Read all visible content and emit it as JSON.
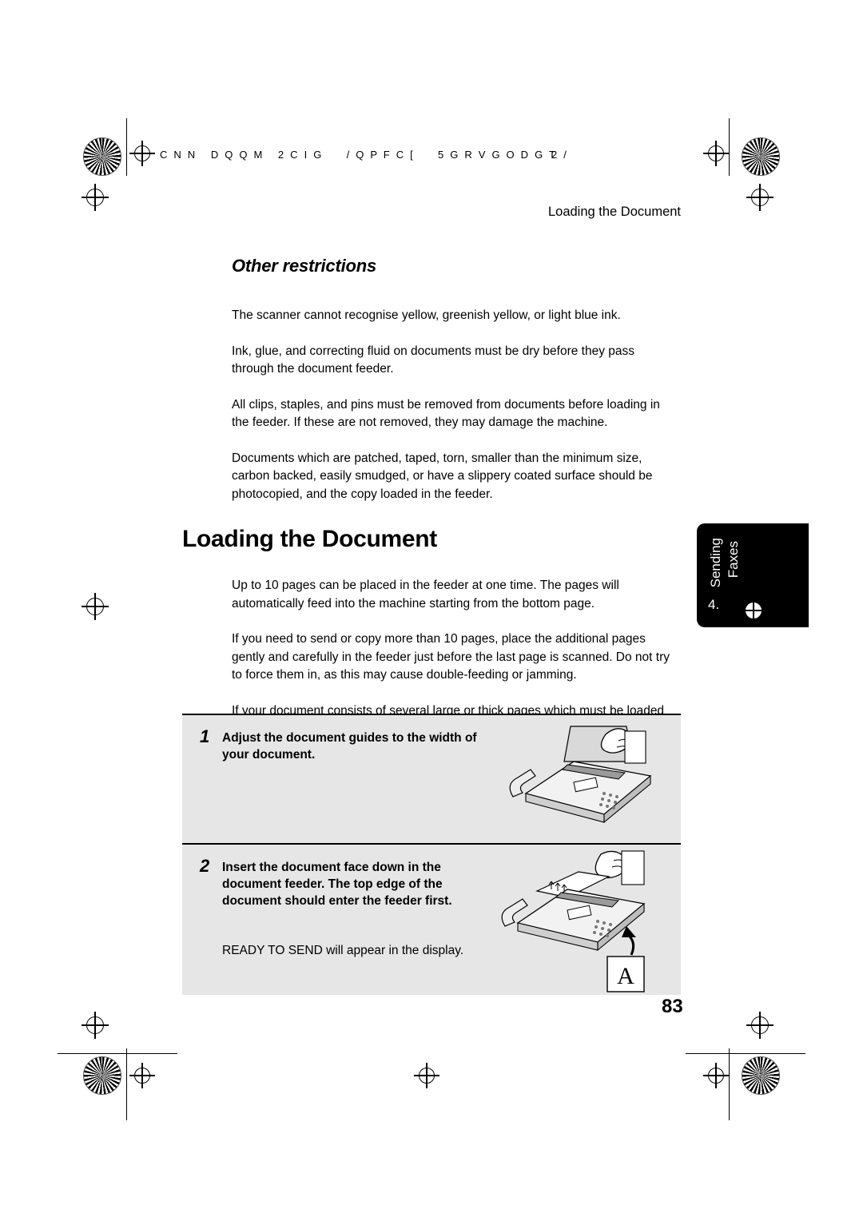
{
  "header": {
    "scrambled_left": "C N N   D Q Q M   2 C I G     / Q P F C [     5 G R V G O D G T",
    "scrambled_right": "2 /",
    "running_head": "Loading the Document"
  },
  "sections": {
    "subheading": "Other restrictions",
    "restriction_paragraphs": [
      "The scanner cannot recognise yellow, greenish yellow, or light blue ink.",
      "Ink, glue, and correcting fluid on documents must be dry before they pass through the document feeder.",
      "All clips, staples, and pins must be removed from documents before loading in the feeder. If these are not removed, they may damage the machine.",
      "Documents which are patched, taped, torn, smaller than the minimum size, carbon backed, easily smudged, or have a slippery coated surface should be photocopied, and the copy loaded in the feeder."
    ],
    "main_heading": "Loading the Document",
    "loading_paragraphs": [
      "Up to 10 pages can be placed in the feeder at one time. The pages will automatically feed into the machine starting from the bottom page.",
      "If you need to send or copy more than 10 pages, place the additional pages gently and carefully in the feeder just before the last page is scanned. Do not try to force them in, as this may cause double-feeding or jamming.",
      "If your document consists of several large or thick pages which must be loaded one at a time, insert each page into the feeder as the previous page is being scanned. Insert gently to prevent double-feeding."
    ]
  },
  "steps": [
    {
      "number": "1",
      "text": "Adjust the document guides to the width of your document.",
      "note": ""
    },
    {
      "number": "2",
      "text": "Insert the document face down in the document feeder. The top edge of the document should enter the feeder first.",
      "note": "READY TO SEND will appear in the display."
    }
  ],
  "side_tab": {
    "line1": "Sending",
    "line2": "Faxes",
    "prefix": "4."
  },
  "page_number": "83"
}
